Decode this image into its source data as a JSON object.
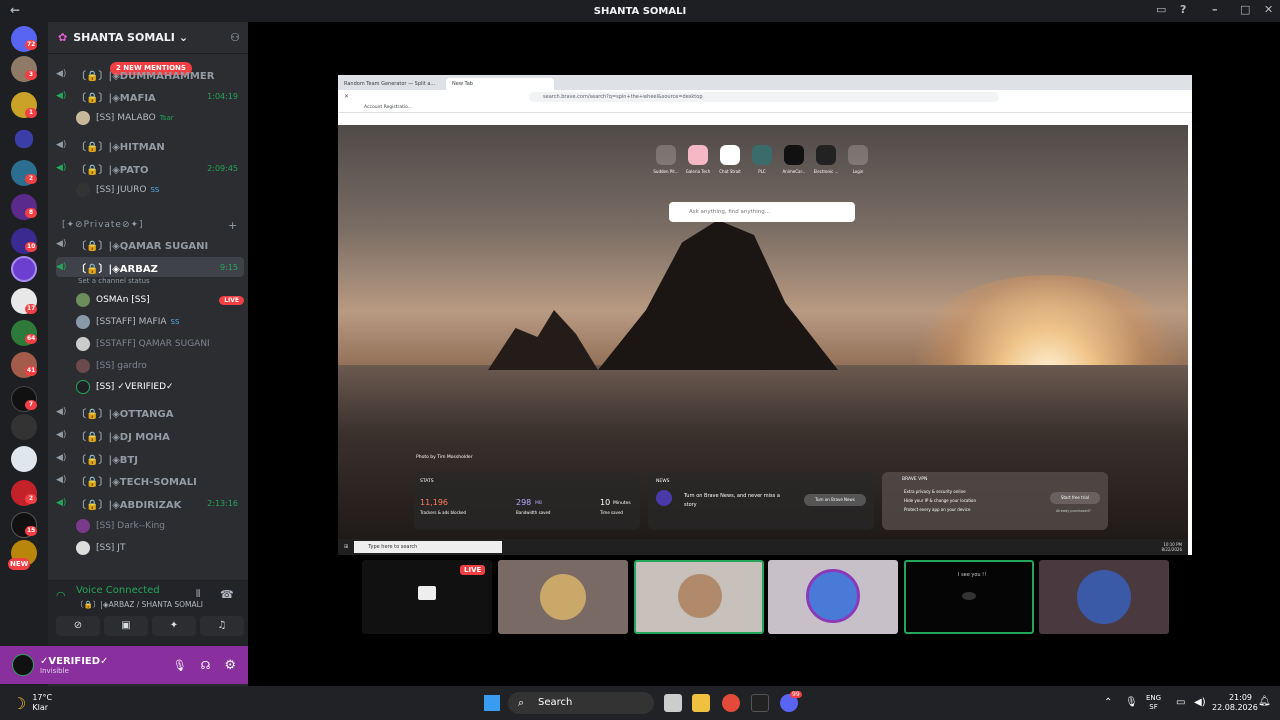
{
  "window": {
    "title": "SHANTA SOMALI"
  },
  "server": {
    "name": "SHANTA SOMALI",
    "mentions": "2 NEW MENTIONS"
  },
  "guild_badges": [
    "72",
    "3",
    "1",
    "2",
    "8",
    "10",
    "17",
    "64",
    "41",
    "7",
    "2",
    "15",
    "NEW"
  ],
  "channels": [
    {
      "name": "〔🔒〕|◈DUMMAHAMMER",
      "timer": "",
      "speaking": false
    },
    {
      "name": "〔🔒〕|◈MAFIA",
      "timer": "1:04:19",
      "speaking": true
    },
    {
      "name": "〔🔒〕|◈HITMAN",
      "timer": "",
      "speaking": false
    },
    {
      "name": "〔🔒〕|◈PATO",
      "timer": "2:09:45",
      "speaking": true
    },
    {
      "name": "〔🔒〕|◈QAMAR SUGANI",
      "timer": "",
      "speaking": false
    },
    {
      "name": "〔🔒〕|◈ARBAZ",
      "timer": "9:15",
      "speaking": true
    },
    {
      "name": "〔🔒〕|◈OTTANGA",
      "timer": "",
      "speaking": false
    },
    {
      "name": "〔🔒〕|◈DJ MOHA",
      "timer": "",
      "speaking": false
    },
    {
      "name": "〔🔒〕|◈BTJ",
      "timer": "",
      "speaking": false
    },
    {
      "name": "〔🔒〕|◈TECH-SOMALI",
      "timer": "",
      "speaking": false
    },
    {
      "name": "〔🔒〕|◈ABDIRIZAK",
      "timer": "2:13:16",
      "speaking": true
    }
  ],
  "category": "[✦⊘Private⊘✦]",
  "channel_status": "Set a channel status",
  "users": {
    "mafia": [
      {
        "name": "⁅SS⁆ MALABO",
        "tag": "Tsar"
      }
    ],
    "pato": [
      {
        "name": "⁅SS⁆ JUURO",
        "tag": "SS"
      }
    ],
    "arbaz": [
      {
        "name": "OSMAn ⁅SS⁆",
        "tag": "LIVE"
      },
      {
        "name": "⁅SSTAFF⁆ MAFIA",
        "tag": "SS"
      },
      {
        "name": "⁅SSTAFF⁆ QAMAR SUGANI",
        "tag": ""
      },
      {
        "name": "⁅SS⁆ gardro",
        "tag": ""
      },
      {
        "name": "⁅SS⁆ ✓VERIFIED✓",
        "tag": ""
      }
    ],
    "abdirizak": [
      {
        "name": "⁅SS⁆ Dark--King",
        "tag": ""
      },
      {
        "name": "⁅SS⁆ JT",
        "tag": ""
      }
    ]
  },
  "voice": {
    "status": "Voice Connected",
    "channel": "〔🔒〕|◈ARBAZ / SHANTA SOMALI"
  },
  "me": {
    "name": "✓VERIFIED✓",
    "status": "Invisible"
  },
  "browser": {
    "tabs": [
      "Random Team Generator — Split a...",
      "New Tab"
    ],
    "url": "search.brave.com/search?q=spin+the+wheel&source=desktop",
    "bookmark": "Account Registratio...",
    "tiles": [
      "Sudden Pit...",
      "Galeria Tech",
      "Chat Strait",
      "PLC",
      "AnimeCar...",
      "Electronic ...",
      "Login"
    ],
    "search_placeholder": "Ask anything, find anything...",
    "photo_credit": "Photo by Tim Mossholder",
    "stats": {
      "title": "STATS",
      "trackers": "11,196",
      "trackers_label": "Trackers & ads blocked",
      "bandwidth": "298",
      "bandwidth_unit": "MB",
      "bandwidth_label": "Bandwidth saved",
      "time": "10",
      "time_unit": "Minutes",
      "time_label": "Time saved"
    },
    "news": {
      "title": "NEWS",
      "text": "Turn on Brave News, and never miss a story",
      "button": "Turn on Brave News"
    },
    "vpn": {
      "title": "BRAVE VPN",
      "l1": "Extra privacy & security online",
      "l2": "Hide your IP & change your location",
      "l3": "Protect every app on your device",
      "button": "Start free trial",
      "already": "Already purchased?"
    },
    "inner_search": "Type here to search",
    "inner_time": "10:10 PM",
    "inner_date": "8/22/2026"
  },
  "thumbs": [
    {
      "label": "LIVE"
    },
    {
      "label": ""
    },
    {
      "label": ""
    },
    {
      "label": ""
    },
    {
      "label": "I see you !!"
    },
    {
      "label": ""
    }
  ],
  "taskbar": {
    "weather_temp": "17°C",
    "weather_text": "Klar",
    "search": "Search",
    "lang1": "ENG",
    "lang2": "SF",
    "time": "21:09",
    "date": "22.08.2026",
    "discord_badge": "99"
  }
}
